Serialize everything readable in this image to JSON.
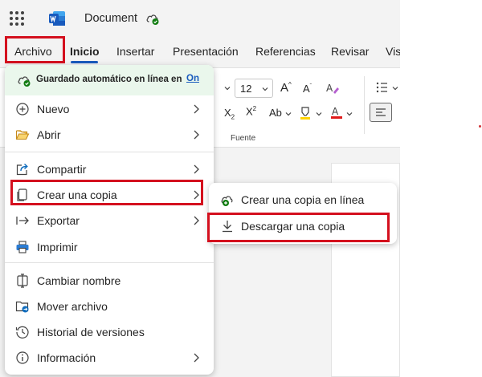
{
  "titlebar": {
    "doc_title": "Document",
    "app_icon": "word-logo",
    "sync_icon": "cloud-check-icon"
  },
  "tabs": [
    {
      "label": "Archivo",
      "active": false,
      "highlighted": true
    },
    {
      "label": "Inicio",
      "active": true
    },
    {
      "label": "Insertar"
    },
    {
      "label": "Presentación"
    },
    {
      "label": "Referencias"
    },
    {
      "label": "Revisar"
    },
    {
      "label": "Vis"
    }
  ],
  "ribbon": {
    "font_size": "12",
    "group_label": "Fuente"
  },
  "file_menu": {
    "autosave": {
      "text": "Guardado automático en línea en",
      "toggle": "On"
    },
    "items": [
      {
        "label": "Nuevo",
        "icon": "plus-circle-icon",
        "submenu": true
      },
      {
        "label": "Abrir",
        "icon": "folder-open-icon",
        "submenu": true
      },
      {
        "label": "Compartir",
        "icon": "share-icon",
        "submenu": true
      },
      {
        "label": "Crear una copia",
        "icon": "copy-document-icon",
        "submenu": true,
        "highlighted": true
      },
      {
        "label": "Exportar",
        "icon": "export-arrow-icon",
        "submenu": true
      },
      {
        "label": "Imprimir",
        "icon": "printer-icon",
        "submenu": false
      },
      {
        "label": "Cambiar nombre",
        "icon": "rename-icon",
        "submenu": false
      },
      {
        "label": "Mover archivo",
        "icon": "folder-move-icon",
        "submenu": false
      },
      {
        "label": "Historial de versiones",
        "icon": "history-icon",
        "submenu": false
      },
      {
        "label": "Información",
        "icon": "info-icon",
        "submenu": true
      }
    ]
  },
  "copy_submenu": {
    "items": [
      {
        "label": "Crear una copia en línea",
        "icon": "cloud-add-icon"
      },
      {
        "label": "Descargar una copia",
        "icon": "download-icon",
        "highlighted": true
      }
    ]
  },
  "colors": {
    "highlight_border": "#d4101e",
    "accent_blue": "#185abd",
    "word_blue": "#185abd",
    "autosave_bg": "#eaf7ec",
    "green_check": "#107c10"
  }
}
